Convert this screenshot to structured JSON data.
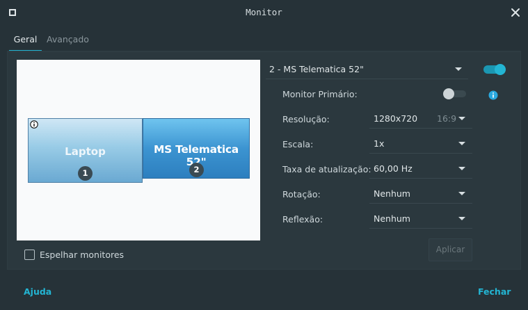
{
  "window": {
    "title": "Monitor"
  },
  "tabs": [
    {
      "label": "Geral",
      "active": true
    },
    {
      "label": "Avançado",
      "active": false
    }
  ],
  "preview": {
    "monitors": [
      {
        "name": "Laptop",
        "number": "1"
      },
      {
        "name": "MS Telematica 52\"",
        "number": "2"
      }
    ]
  },
  "mirror": {
    "label": "Espelhar monitores",
    "checked": false
  },
  "monitor_select": {
    "value": "2 - MS Telematica 52\"",
    "enabled": true
  },
  "settings": {
    "primary": {
      "label": "Monitor Primário:",
      "on": false
    },
    "resolution": {
      "label": "Resolução:",
      "value": "1280x720",
      "aspect": "16:9"
    },
    "scale": {
      "label": "Escala:",
      "value": "1x"
    },
    "refresh": {
      "label": "Taxa de atualização:",
      "value": "60,00 Hz"
    },
    "rotation": {
      "label": "Rotação:",
      "value": "Nenhum"
    },
    "reflection": {
      "label": "Reflexão:",
      "value": "Nenhum"
    }
  },
  "buttons": {
    "apply": "Aplicar",
    "help": "Ajuda",
    "close": "Fechar"
  },
  "colors": {
    "accent": "#23b5d3",
    "background": "#263238",
    "panel": "#2b383e"
  },
  "icons": {
    "window_menu": "square-icon",
    "close": "close-icon",
    "info": "info-icon",
    "dropdown": "chevron-down-icon"
  }
}
